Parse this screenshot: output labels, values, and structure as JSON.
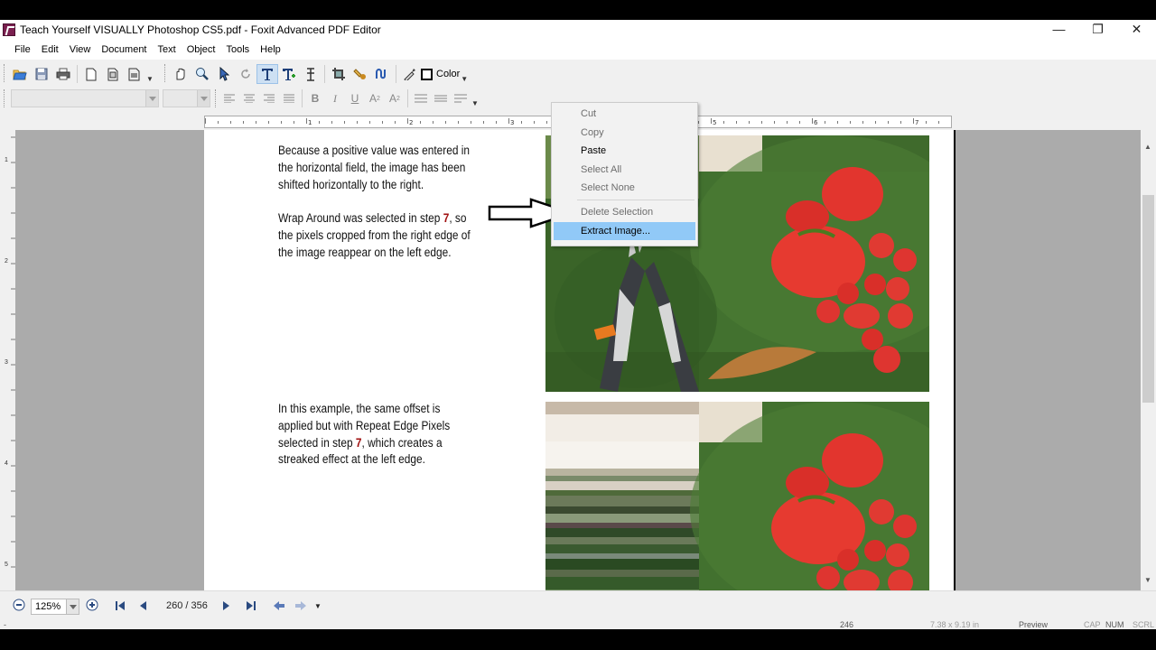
{
  "window": {
    "title": "Teach Yourself VISUALLY Photoshop CS5.pdf - Foxit Advanced PDF Editor",
    "controls": [
      "—",
      "❐",
      "✕"
    ]
  },
  "menubar": [
    "File",
    "Edit",
    "View",
    "Document",
    "Text",
    "Object",
    "Tools",
    "Help"
  ],
  "toolbar": {
    "color_label": "Color"
  },
  "document": {
    "paragraphs": [
      {
        "text": "Because a positive value was entered in the horizontal field, the image has been shifted horizontally to the right."
      },
      {
        "before": "Wrap Around was selected in step ",
        "step": "7",
        "after": ", so the pixels cropped from the right edge of the image reappear on the left edge."
      },
      {
        "before": "In this example, the same offset is applied but with Repeat Edge Pixels selected in step ",
        "step": "7",
        "after": ", which creates a streaked effect at the left edge."
      }
    ]
  },
  "context_menu": {
    "items": [
      {
        "label": "Cut",
        "enabled": false
      },
      {
        "label": "Copy",
        "enabled": false
      },
      {
        "label": "Paste",
        "enabled": true
      },
      {
        "label": "Select All",
        "enabled": false
      },
      {
        "label": "Select None",
        "enabled": false
      },
      {
        "label": "Delete Selection",
        "enabled": false
      },
      {
        "label": "Extract Image...",
        "enabled": true,
        "highlighted": true
      }
    ]
  },
  "vruler_numbers": [
    "1",
    "2",
    "3",
    "4",
    "5"
  ],
  "hruler_numbers": [
    "1",
    "2",
    "3",
    "4",
    "5",
    "6",
    "7"
  ],
  "statusbar": {
    "zoom": "125%",
    "page_indicator": "260 / 356",
    "page_number": "246",
    "page_size": "7.38 x 9.19 in",
    "mode": "Preview",
    "indicators": [
      "CAP",
      "NUM",
      "SCRL"
    ]
  },
  "colors": {
    "highlight": "#91c9f7",
    "step_number": "#a01010",
    "page_background": "#ababab"
  }
}
